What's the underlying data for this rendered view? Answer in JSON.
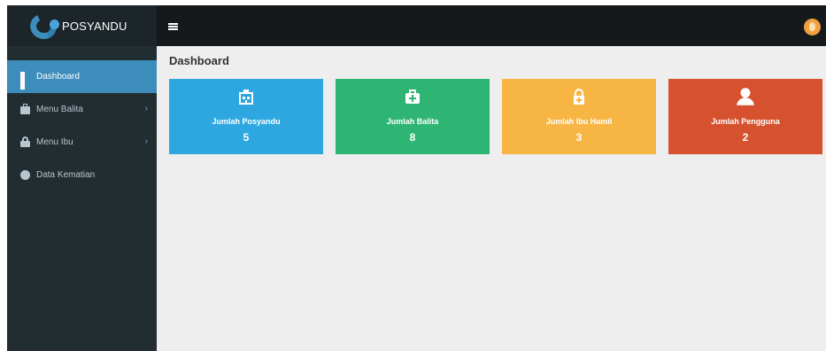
{
  "brand": {
    "name": "POSYANDU"
  },
  "sidebar": {
    "items": [
      {
        "label": "Dashboard",
        "icon": "dashboard-icon",
        "active": true
      },
      {
        "label": "Menu Balita",
        "icon": "briefcase-medical-icon",
        "has_submenu": true
      },
      {
        "label": "Menu Ibu",
        "icon": "lock-icon",
        "has_submenu": true
      },
      {
        "label": "Data Kematian",
        "icon": "skull-icon"
      }
    ]
  },
  "header": {
    "menu_icon": "hamburger-icon",
    "avatar_icon": "user-avatar-icon"
  },
  "main": {
    "title": "Dashboard",
    "cards": [
      {
        "label": "Jumlah Posyandu",
        "value": "5",
        "color": "#2ea7e0",
        "icon": "hospital-building-icon"
      },
      {
        "label": "Jumlah Balita",
        "value": "8",
        "color": "#2fb573",
        "icon": "medical-kit-icon"
      },
      {
        "label": "Jumlah Ibu Hamil",
        "value": "3",
        "color": "#f7b543",
        "icon": "lock-plus-icon"
      },
      {
        "label": "Jumlah Pengguna",
        "value": "2",
        "color": "#d6522e",
        "icon": "user-icon"
      }
    ]
  },
  "colors": {
    "sidebar": "#222d32",
    "topbar": "#16191c",
    "active": "#3c8dbc",
    "content_bg": "#eeeeee"
  }
}
